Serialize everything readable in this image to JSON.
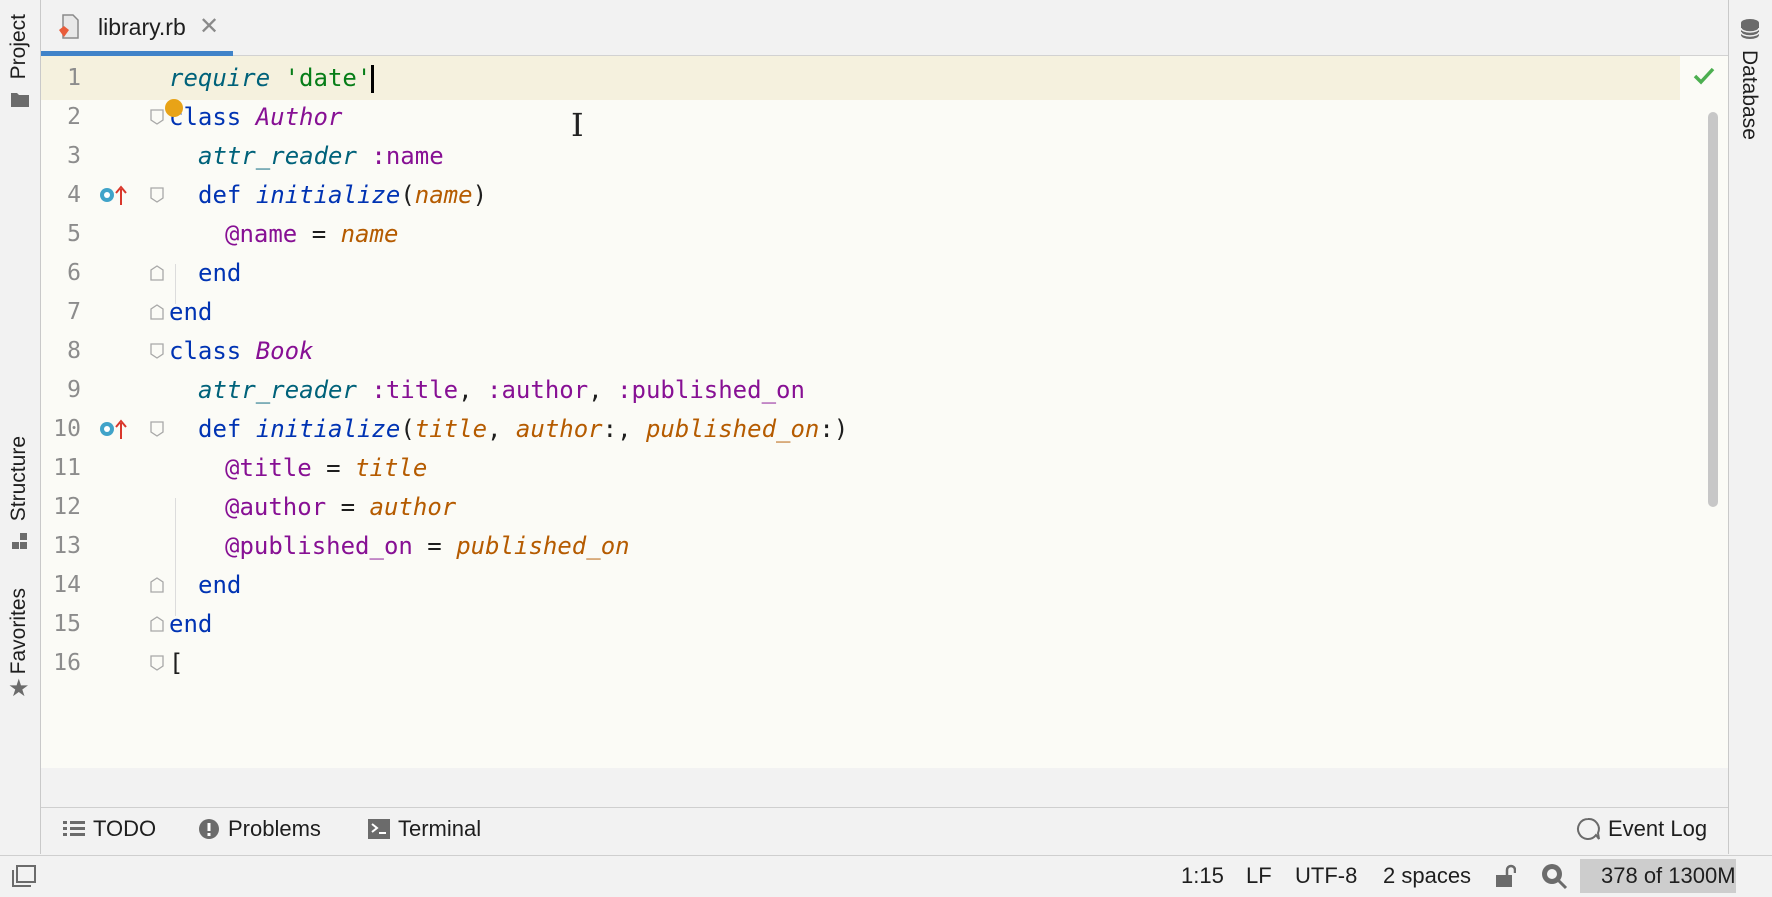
{
  "tabs": [
    {
      "label": "library.rb"
    }
  ],
  "sidebar_left": {
    "project": "Project",
    "structure": "Structure",
    "favorites": "Favorites"
  },
  "sidebar_right": {
    "database": "Database"
  },
  "code_lines": [
    {
      "n": "1"
    },
    {
      "n": "2"
    },
    {
      "n": "3"
    },
    {
      "n": "4"
    },
    {
      "n": "5"
    },
    {
      "n": "6"
    },
    {
      "n": "7"
    },
    {
      "n": "8"
    },
    {
      "n": "9"
    },
    {
      "n": "10"
    },
    {
      "n": "11"
    },
    {
      "n": "12"
    },
    {
      "n": "13"
    },
    {
      "n": "14"
    },
    {
      "n": "15"
    },
    {
      "n": "16"
    }
  ],
  "code": {
    "l1": [
      "require",
      " ",
      "'date'"
    ],
    "l2": [
      "class",
      " ",
      "Author"
    ],
    "l3": [
      "attr_reader",
      " ",
      ":name"
    ],
    "l4": [
      "def",
      " ",
      "initialize",
      "(",
      "name",
      ")"
    ],
    "l5": [
      "@name",
      " = ",
      "name"
    ],
    "l6": [
      "end"
    ],
    "l7": [
      "end"
    ],
    "l8": [
      "class",
      " ",
      "Book"
    ],
    "l9": [
      "attr_reader",
      " ",
      ":title",
      ", ",
      ":author",
      ", ",
      ":published_on"
    ],
    "l10": [
      "def",
      " ",
      "initialize",
      "(",
      "title",
      ", ",
      "author",
      ":, ",
      "published_on",
      ":)"
    ],
    "l11": [
      "@title",
      " = ",
      "title"
    ],
    "l12": [
      "@author",
      " = ",
      "author"
    ],
    "l13": [
      "@published_on",
      " = ",
      "published_on"
    ],
    "l14": [
      "end"
    ],
    "l15": [
      "end"
    ],
    "l16": [
      "["
    ]
  },
  "bottom_tools": {
    "todo": "TODO",
    "problems": "Problems",
    "terminal": "Terminal",
    "event_log": "Event Log"
  },
  "status": {
    "position": "1:15",
    "line_sep": "LF",
    "encoding": "UTF-8",
    "indent": "2 spaces",
    "memory": "378 of 1300M"
  },
  "colors": {
    "accent": "#4083c9",
    "keyword": "#0033b3",
    "class": "#871094",
    "method": "#00627a",
    "param": "#b55b00",
    "string": "#067d17",
    "check": "#4caf50"
  }
}
